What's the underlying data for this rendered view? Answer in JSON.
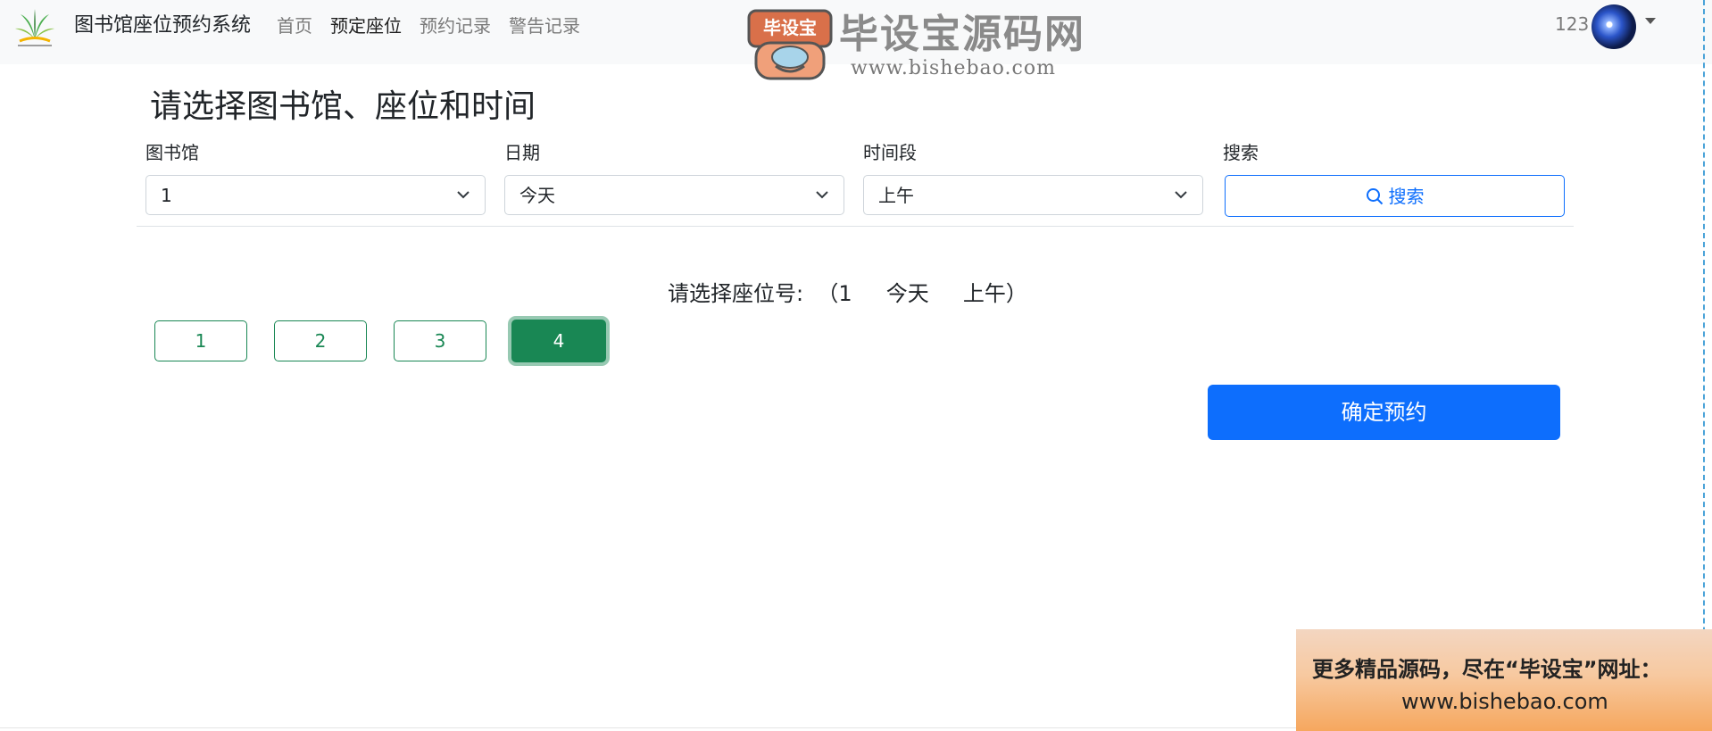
{
  "navbar": {
    "brand": "图书馆座位预约系统",
    "links": [
      "首页",
      "预定座位",
      "预约记录",
      "警告记录"
    ],
    "active_link": "预定座位",
    "user": "123"
  },
  "watermark": {
    "badge_text": "毕设宝",
    "title": "毕设宝源码网",
    "url": "www.bishebao.com"
  },
  "form": {
    "heading": "请选择图书馆、座位和时间",
    "library_label": "图书馆",
    "library_value": "1",
    "date_label": "日期",
    "date_value": "今天",
    "period_label": "时间段",
    "period_value": "上午",
    "search_label": "搜索",
    "search_button": "搜索"
  },
  "seats": {
    "prompt": "请选择座位号:",
    "summary": "（1     今天     上午）",
    "items": [
      "1",
      "2",
      "3",
      "4"
    ],
    "selected": "4"
  },
  "confirm_button": "确定预约",
  "promo": {
    "line1": "更多精品源码，尽在“毕设宝”网址：",
    "line2": "www.bishebao.com"
  },
  "colors": {
    "primary": "#0d6efd",
    "success": "#198754",
    "navbar_bg": "#f8f9fa"
  }
}
